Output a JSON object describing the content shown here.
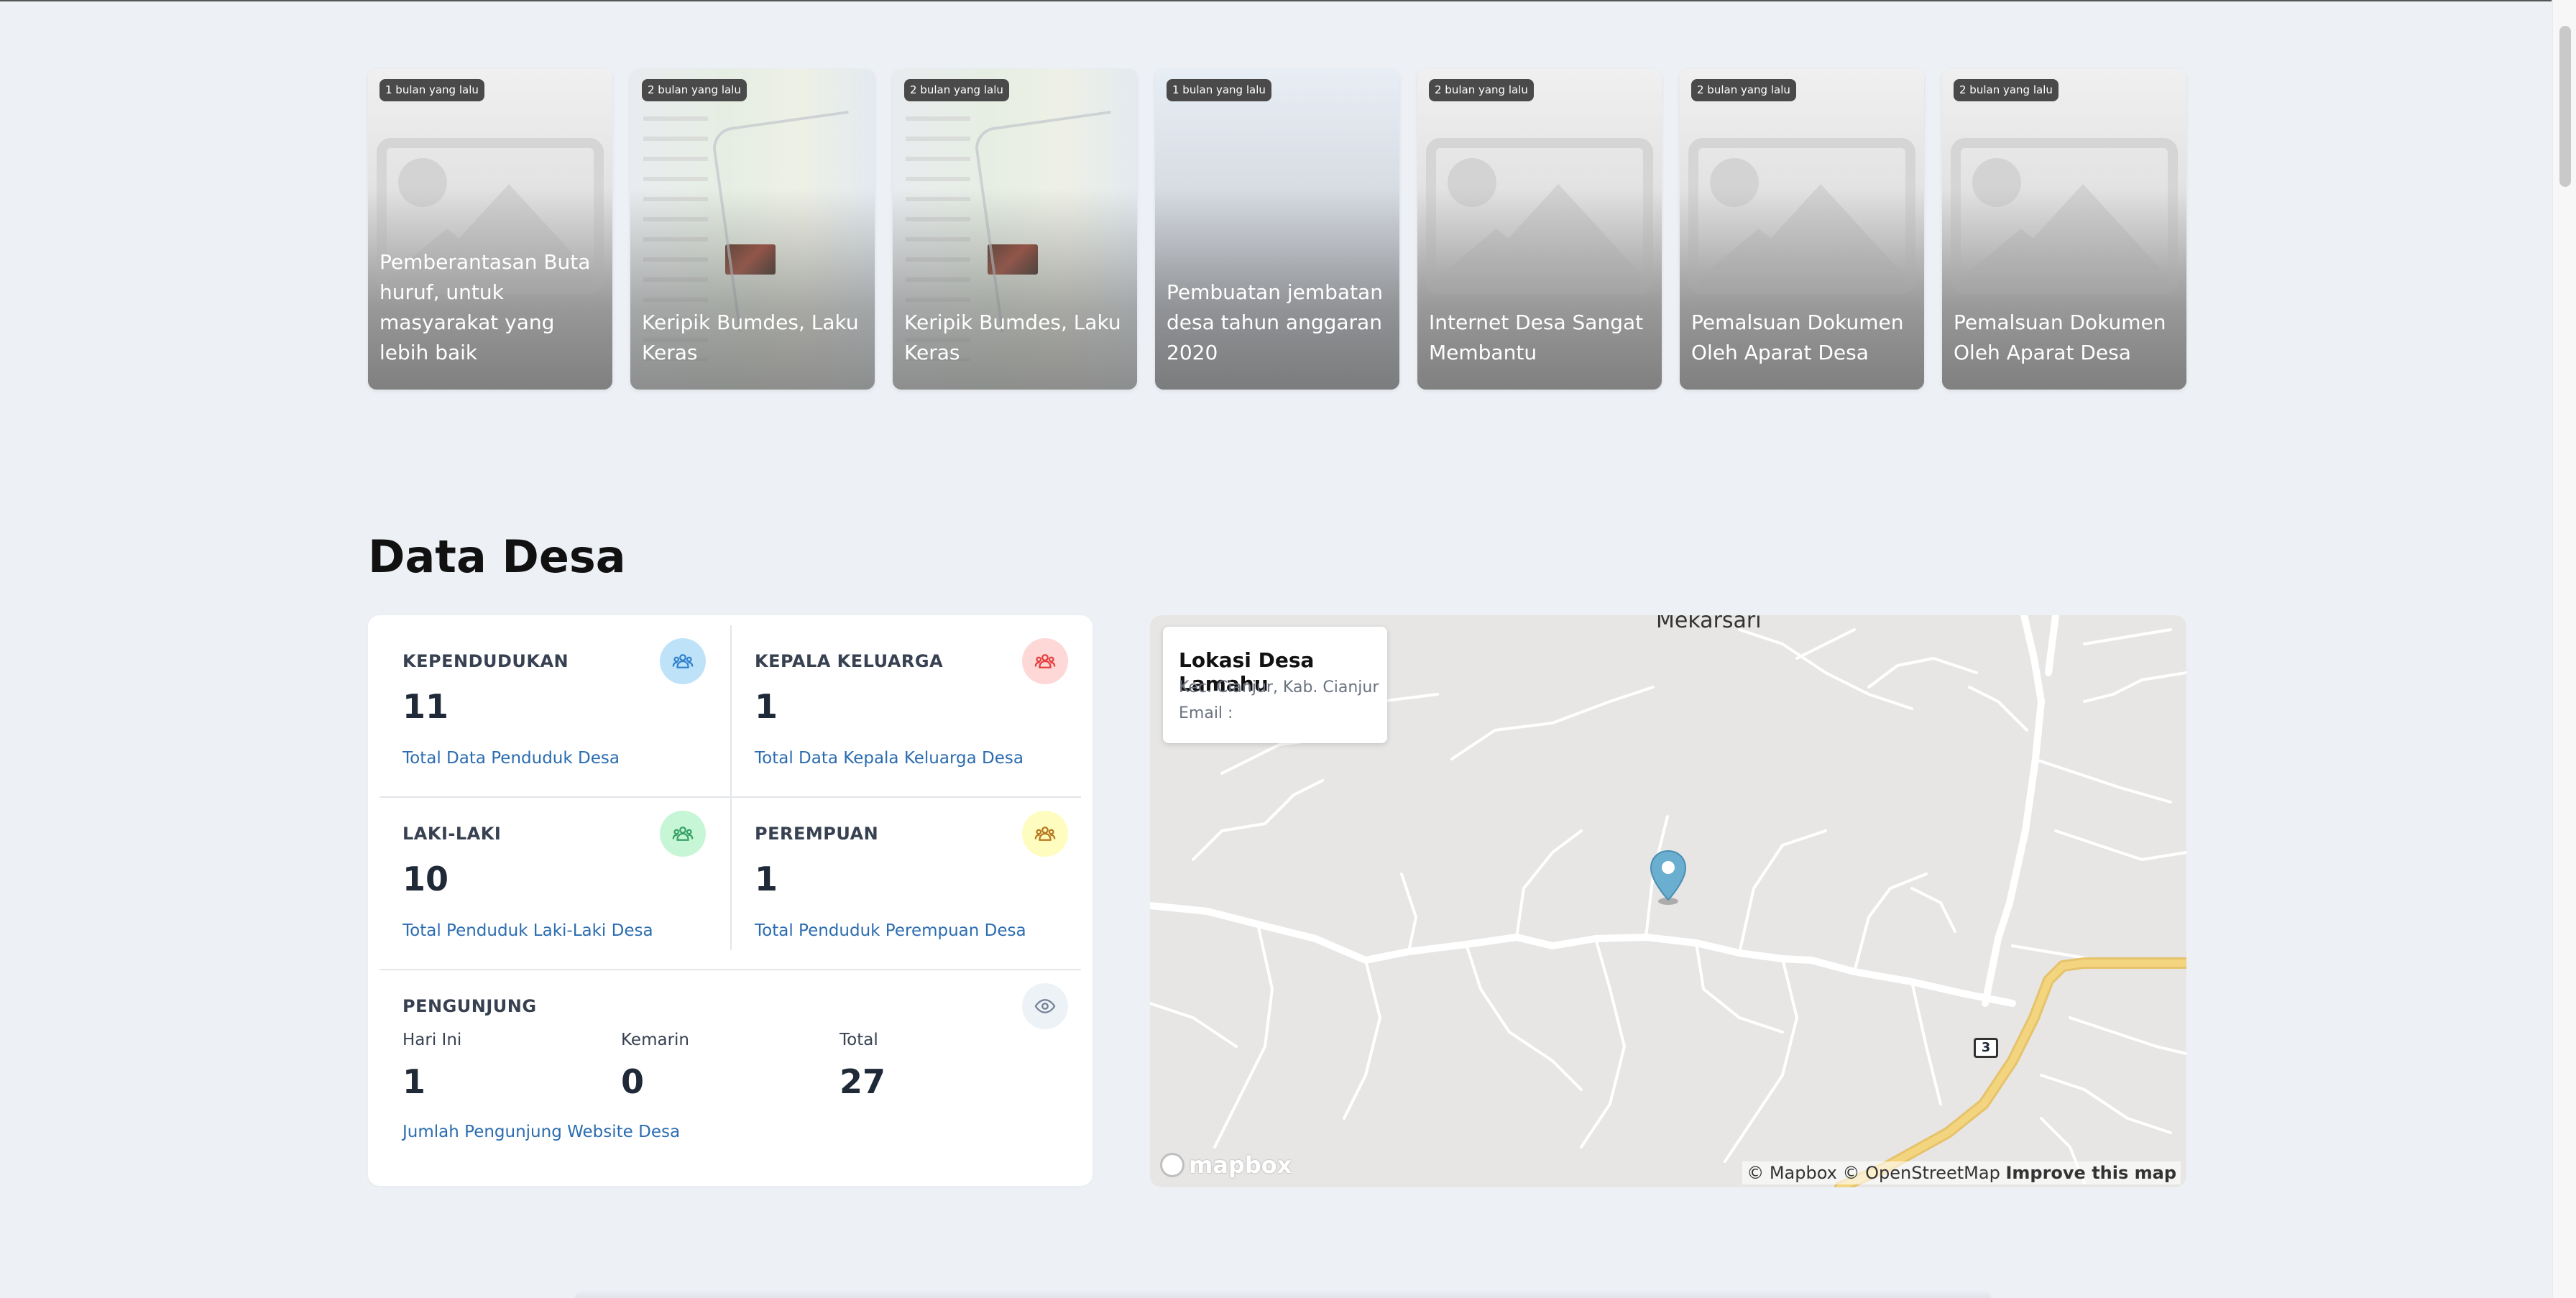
{
  "news": {
    "cards": [
      {
        "badge": "1 bulan yang lalu",
        "title": "Pemberantasan Buta huruf, untuk masyarakat yang lebih baik",
        "image": "placeholder"
      },
      {
        "badge": "2 bulan yang lalu",
        "title": "Keripik Bumdes, Laku Keras",
        "image": "map-screenshot"
      },
      {
        "badge": "2 bulan yang lalu",
        "title": "Keripik Bumdes, Laku Keras",
        "image": "map-screenshot"
      },
      {
        "badge": "1 bulan yang lalu",
        "title": "Pembuatan jembatan desa tahun anggaran 2020",
        "image": "photo"
      },
      {
        "badge": "2 bulan yang lalu",
        "title": "Internet Desa Sangat Membantu",
        "image": "placeholder"
      },
      {
        "badge": "2 bulan yang lalu",
        "title": "Pemalsuan Dokumen Oleh Aparat Desa",
        "image": "placeholder"
      },
      {
        "badge": "2 bulan yang lalu",
        "title": "Pemalsuan Dokumen Oleh Aparat Desa",
        "image": "placeholder"
      }
    ]
  },
  "section": {
    "title": "Data Desa"
  },
  "stats": {
    "population": {
      "label": "KEPENDUDUKAN",
      "value": "11",
      "sub": "Total Data Penduduk Desa",
      "icon": "people-icon",
      "color": "#90cdf4"
    },
    "family": {
      "label": "KEPALA KELUARGA",
      "value": "1",
      "sub": "Total Data Kepala Keluarga Desa",
      "icon": "people-icon",
      "color": "#feb2b2"
    },
    "male": {
      "label": "LAKI-LAKI",
      "value": "10",
      "sub": "Total Penduduk Laki-Laki Desa",
      "icon": "people-icon",
      "color": "#9ae6b4"
    },
    "female": {
      "label": "PEREMPUAN",
      "value": "1",
      "sub": "Total Penduduk Perempuan Desa",
      "icon": "people-icon",
      "color": "#faf089"
    },
    "visitors": {
      "label": "PENGUNJUNG",
      "icon": "eye-icon",
      "today_label": "Hari Ini",
      "today": "1",
      "yesterday_label": "Kemarin",
      "yesterday": "0",
      "total_label": "Total",
      "total": "27",
      "sub": "Jumlah Pengunjung Website Desa"
    }
  },
  "map": {
    "popup_title": "Lokasi Desa Lamahu",
    "popup_address": "Kec. Cianjur, Kab. Cianjur",
    "popup_email": "Email :",
    "place_label": "Mekarsari",
    "route_shield": "3",
    "attribution_mapbox": "© Mapbox",
    "attribution_osm": "© OpenStreetMap",
    "improve_link": "Improve this map",
    "logo_text": "mapbox",
    "marker_color": "#6aaed0"
  }
}
